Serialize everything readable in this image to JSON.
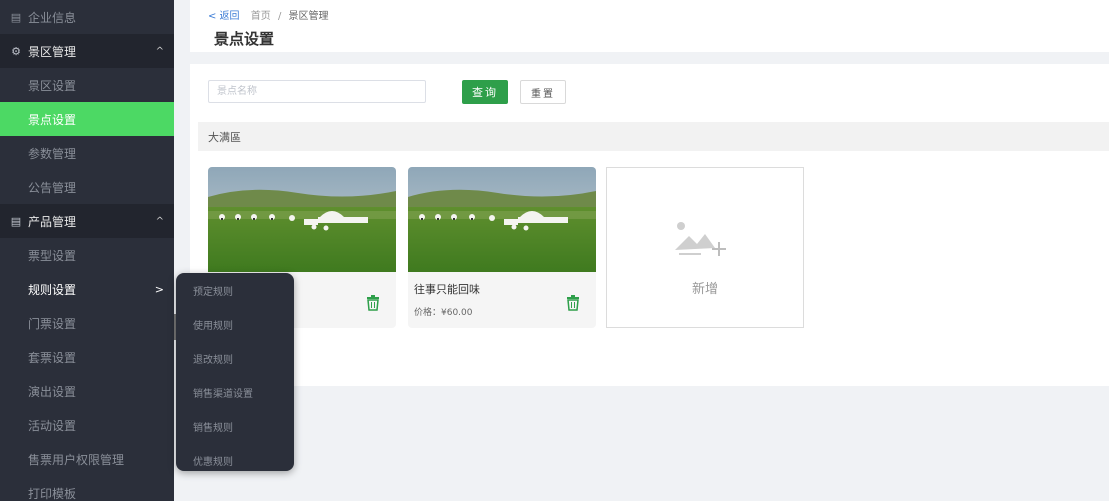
{
  "sidebar": {
    "top_item": {
      "label": "企业信息",
      "icon": "document-icon"
    },
    "groups": [
      {
        "label": "景区管理",
        "icon": "gear-icon",
        "caret": "^",
        "items": [
          {
            "label": "景区设置"
          },
          {
            "label": "景点设置",
            "active": true
          },
          {
            "label": "参数管理"
          },
          {
            "label": "公告管理"
          }
        ]
      },
      {
        "label": "产品管理",
        "icon": "document-icon",
        "caret": "^",
        "items": [
          {
            "label": "票型设置"
          },
          {
            "label": "规则设置",
            "arrow": ">"
          },
          {
            "label": "门票设置"
          },
          {
            "label": "套票设置"
          },
          {
            "label": "演出设置"
          },
          {
            "label": "活动设置"
          },
          {
            "label": "售票用户权限管理"
          },
          {
            "label": "打印模板"
          }
        ]
      }
    ],
    "colors": {
      "bg": "#2b2f3a",
      "active": "#4cd964"
    }
  },
  "header": {
    "back_label": "< 返回",
    "breadcrumb": [
      "首页",
      "景区管理"
    ],
    "separator": "/",
    "title": "景点设置"
  },
  "search": {
    "placeholder": "景点名称",
    "value": "",
    "query_label": "查询",
    "reset_label": "重置"
  },
  "section": {
    "title": "大满區"
  },
  "cards": [
    {
      "name": "",
      "price": "",
      "image": "yurt-grassland-photo"
    },
    {
      "name": "往事只能回味",
      "price": "价格：¥60.00",
      "image": "yurt-grassland-photo"
    }
  ],
  "add_card": {
    "label": "新增",
    "icon": "add-image-icon"
  },
  "flyout": {
    "items": [
      "预定规则",
      "使用规则",
      "退改规则",
      "销售渠道设置",
      "销售规则",
      "优惠规则"
    ]
  },
  "colors": {
    "accent": "#2e9f4a",
    "link": "#3a7bd5",
    "trash": "#2e9f4a"
  }
}
